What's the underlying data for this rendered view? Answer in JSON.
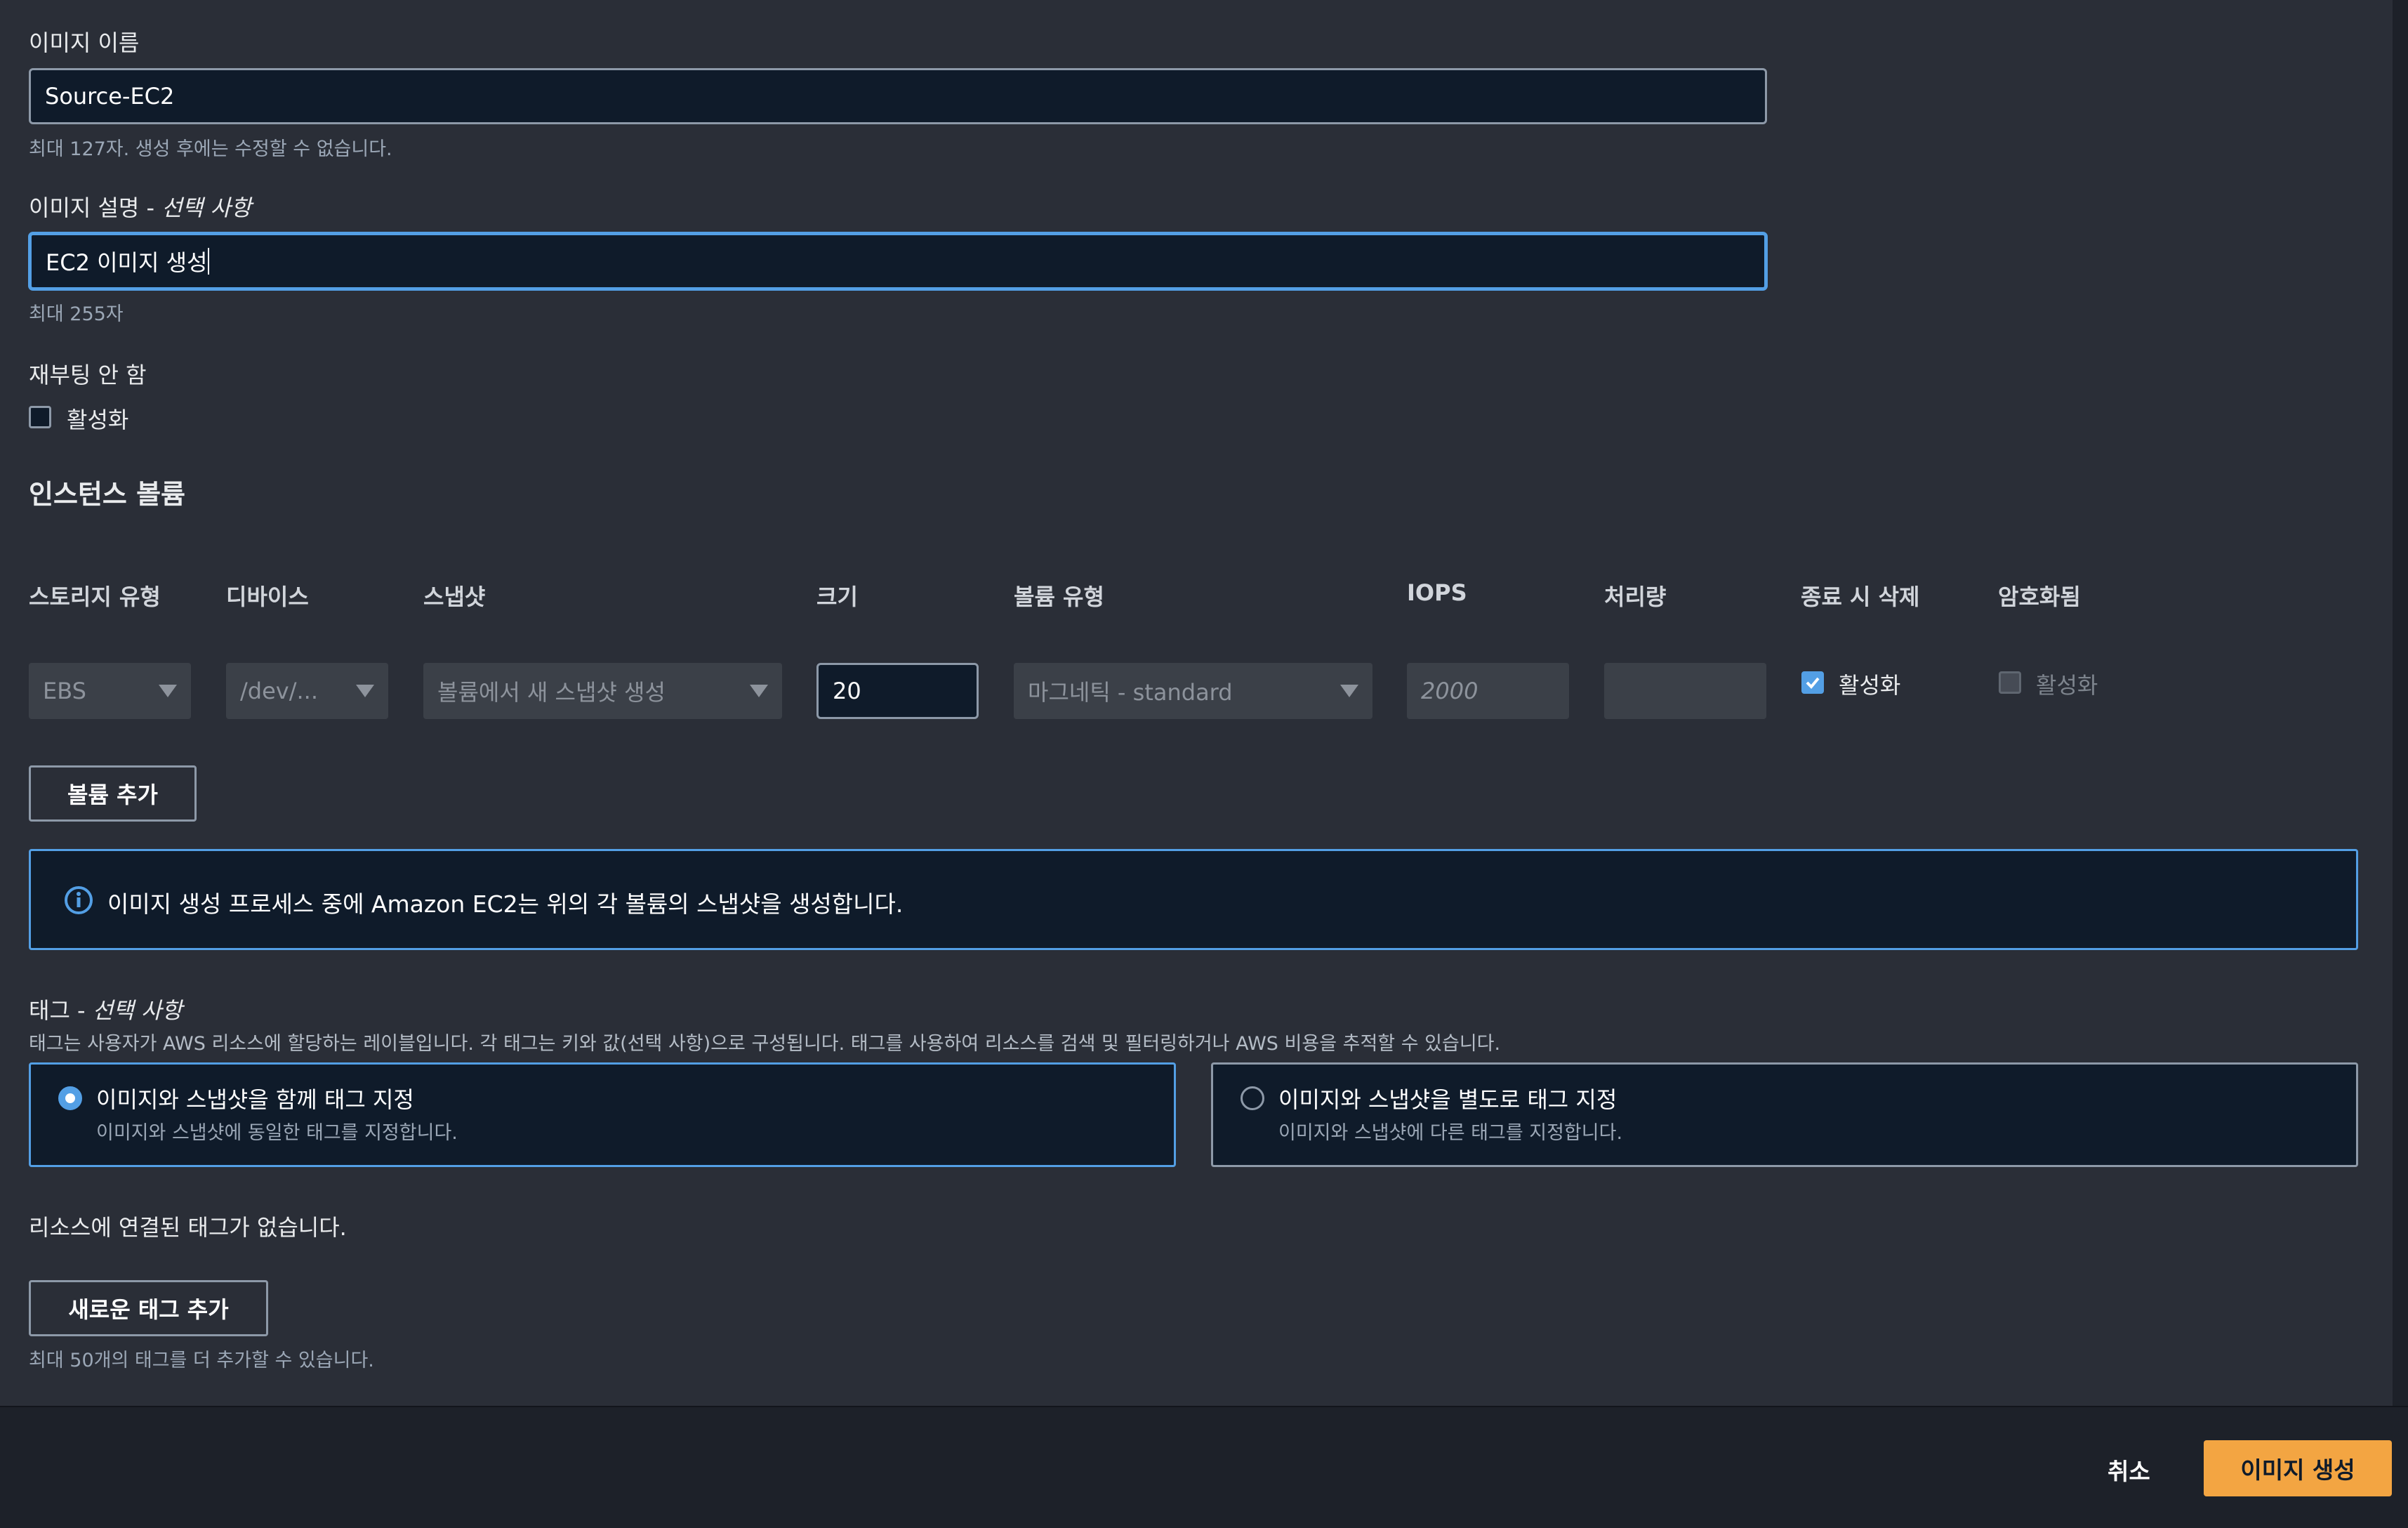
{
  "image_name": {
    "label": "이미지 이름",
    "value": "Source-EC2",
    "hint": "최대 127자. 생성 후에는 수정할 수 없습니다."
  },
  "image_description": {
    "label": "이미지 설명 - ",
    "label_optional": "선택 사항",
    "value": "EC2 이미지 생성",
    "hint": "최대 255자"
  },
  "no_reboot": {
    "label": "재부팅 안 함",
    "checkbox_label": "활성화",
    "checked": false
  },
  "instance_volumes": {
    "title": "인스턴스 볼륨",
    "columns": [
      "스토리지 유형",
      "디바이스",
      "스냅샷",
      "크기",
      "볼륨 유형",
      "IOPS",
      "처리량",
      "종료 시 삭제",
      "암호화됨"
    ],
    "row": {
      "storage_type": "EBS",
      "device": "/dev/...",
      "snapshot_placeholder": "볼륨에서 새 스냅샷 생성",
      "size": "20",
      "volume_type": "마그네틱 - standard",
      "iops": "2000",
      "throughput": "",
      "delete_on_termination_label": "활성화",
      "delete_on_termination": true,
      "encrypted_label": "활성화",
      "encrypted": false
    },
    "add_volume_button": "볼륨 추가"
  },
  "info_banner": {
    "icon": "info-circle-icon",
    "text": "이미지 생성 프로세스 중에 Amazon EC2는 위의 각 볼륨의 스냅샷을 생성합니다."
  },
  "tags": {
    "label": "태그 - ",
    "label_optional": "선택 사항",
    "description": "태그는 사용자가 AWS 리소스에 할당하는 레이블입니다. 각 태그는 키와 값(선택 사항)으로 구성됩니다. 태그를 사용하여 리소스를 검색 및 필터링하거나 AWS 비용을 추적할 수 있습니다.",
    "options": [
      {
        "title": "이미지와 스냅샷을 함께 태그 지정",
        "desc": "이미지와 스냅샷에 동일한 태그를 지정합니다.",
        "selected": true
      },
      {
        "title": "이미지와 스냅샷을 별도로 태그 지정",
        "desc": "이미지와 스냅샷에 다른 태그를 지정합니다.",
        "selected": false
      }
    ],
    "empty_text": "리소스에 연결된 태그가 없습니다.",
    "add_tag_button": "새로운 태그 추가",
    "limit_hint": "최대 50개의 태그를 더 추가할 수 있습니다."
  },
  "footer": {
    "cancel": "취소",
    "create": "이미지 생성"
  },
  "colors": {
    "background": "#2a2e37",
    "footer_background": "#1d2129",
    "accent": "#539fe5",
    "primary_button": "#f3a542",
    "info_background": "#0f1b2a"
  }
}
